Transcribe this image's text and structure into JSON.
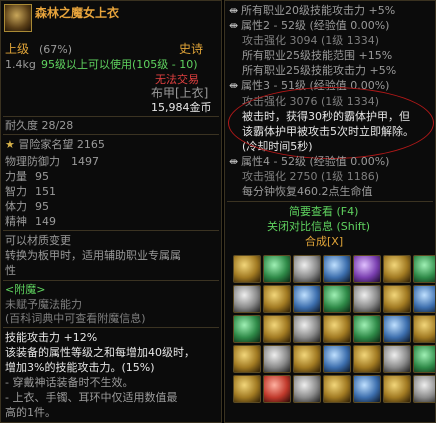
{
  "item": {
    "name": "森林之魔女上衣",
    "grade": "上级",
    "grade_pct": "(67%)",
    "rarity": "史诗",
    "weight": "1.4kg",
    "level_req": "95级以上可以使用(105级 - 10)",
    "trade": "无法交易",
    "type": "布甲[上衣]",
    "price": "15,984金币",
    "durability": "耐久度 28/28",
    "fame": "冒险家名望 2165",
    "def_label": "物理防御力",
    "def_val": "1497",
    "stats": [
      {
        "label": "力量",
        "value": "95"
      },
      {
        "label": "智力",
        "value": "151"
      },
      {
        "label": "体力",
        "value": "95"
      },
      {
        "label": "精神",
        "value": "149"
      }
    ],
    "material_change": "可以材质变更",
    "material_desc1": "转换为板甲时，适用辅助职业专属属",
    "material_desc2": "性",
    "enchant_header": "<附魔>",
    "enchant_none": "未赋予魔法能力",
    "enchant_hint": "(百科词典中可查看附魔信息)",
    "skill_atk": "技能攻击力 +12%",
    "desc1": "该装备的属性等级之和每增加40级时，",
    "desc2": "增加3%的技能攻击力。(15%)",
    "note1": "- 穿戴神话装备时不生效。",
    "note2": "- 上衣、手镯、耳环中仅适用数值最",
    "note3": "高的1件。"
  },
  "right": {
    "lines": [
      "所有职业20级技能攻击力 +5%",
      "属性2 - 52级 (经验值 0.00%)",
      "攻击强化 3094 (1级 1334)",
      "所有职业25级技能范围 +15%",
      "所有职业25级技能攻击力 +5%",
      "属性3 - 51级 (经验值 0.00%)",
      "攻击强化 3076 (1级 1334)",
      "被击时，获得30秒的霸体护甲，但",
      "该霸体护甲被攻击5次时立即解除。",
      "(冷却时间5秒)",
      "属性4 - 52级 (经验值 0.00%)",
      "攻击强化 2750 (1级 1186)",
      "每分钟恢复460.2点生命值"
    ],
    "brief": "简要查看 (F4)",
    "close_related": "关闭对比信息 (Shift)",
    "synthesis": "合成[X]"
  }
}
